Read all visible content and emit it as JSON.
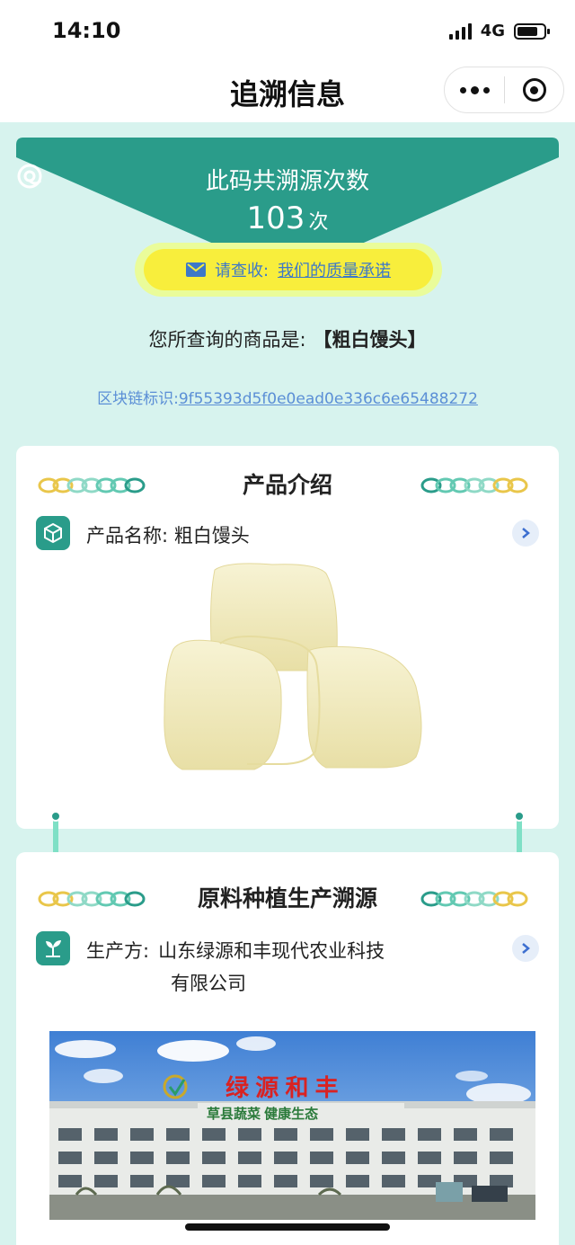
{
  "status_bar": {
    "time": "14:10",
    "network": "4G"
  },
  "nav": {
    "title": "追溯信息"
  },
  "banner": {
    "title": "此码共溯源次数",
    "count": "103",
    "count_unit": "次"
  },
  "promise": {
    "prefix": "请查收:",
    "link": "我们的质量承诺"
  },
  "query": {
    "prefix": "您所查询的商品是:",
    "product": "【粗白馒头】"
  },
  "blockchain": {
    "label": "区块链标识:",
    "hash": "9f55393d5f0e0ead0e336c6e65488272"
  },
  "card_product": {
    "title": "产品介绍",
    "name_label": "产品名称: 粗白馒头"
  },
  "card_origin": {
    "title": "原料种植生产溯源",
    "producer_label": "生产方:",
    "producer_line1": "山东绿源和丰现代农业科技",
    "producer_line2": "有限公司"
  },
  "factory_sign": {
    "brand": "绿  源  和  丰",
    "slogan": "草县蔬菜  健康生态"
  },
  "colors": {
    "teal": "#2a9c8a",
    "page_bg": "#d7f3ee",
    "promise_yellow": "#f8ee3c",
    "link_blue": "#5b8fd6"
  }
}
